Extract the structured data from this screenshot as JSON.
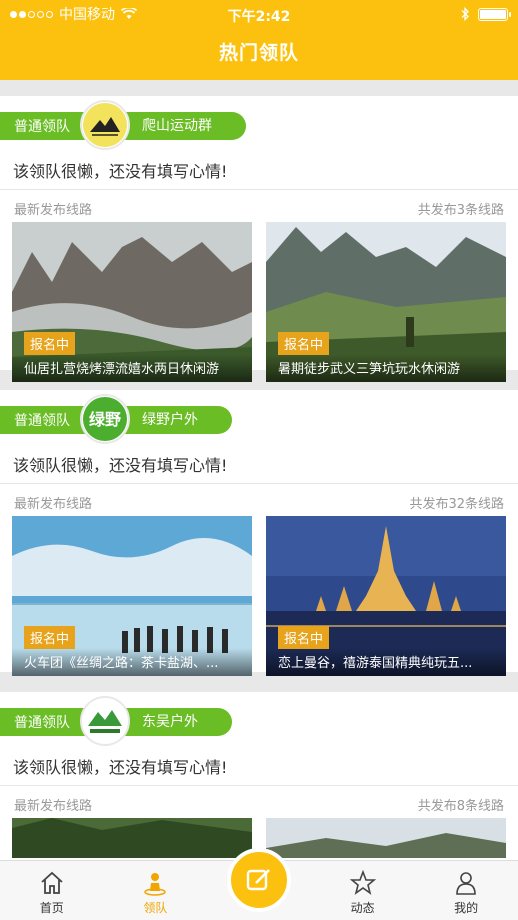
{
  "status_bar": {
    "carrier": "中国移动",
    "time": "下午2:42"
  },
  "header": {
    "title": "热门领队"
  },
  "cards": [
    {
      "type_label": "普通领队",
      "name": "爬山运动群",
      "motto": "该领队很懒，还没有填写心情!",
      "latest_label": "最新发布线路",
      "route_count": "共发布3条线路",
      "routes": [
        {
          "status": "报名中",
          "title": "仙居扎营烧烤漂流嬉水两日休闲游"
        },
        {
          "status": "报名中",
          "title": "暑期徒步武义三笋坑玩水休闲游"
        }
      ]
    },
    {
      "type_label": "普通领队",
      "name": "绿野户外",
      "logo_text": "绿野",
      "motto": "该领队很懒，还没有填写心情!",
      "latest_label": "最新发布线路",
      "route_count": "共发布32条线路",
      "routes": [
        {
          "status": "报名中",
          "title": "火车团《丝绸之路：茶卡盐湖、..."
        },
        {
          "status": "报名中",
          "title": "恋上曼谷，禧游泰国精典纯玩五..."
        }
      ]
    },
    {
      "type_label": "普通领队",
      "name": "东吴户外",
      "motto": "该领队很懒，还没有填写心情!",
      "latest_label": "最新发布线路",
      "route_count": "共发布8条线路",
      "routes": []
    }
  ],
  "tabbar": {
    "items": [
      {
        "label": "首页",
        "icon": "home-icon"
      },
      {
        "label": "领队",
        "icon": "leader-icon"
      },
      {
        "label": "",
        "icon": "compose-icon"
      },
      {
        "label": "动态",
        "icon": "star-icon"
      },
      {
        "label": "我的",
        "icon": "user-icon"
      }
    ],
    "active": "领队"
  },
  "colors": {
    "brand": "#fcc10f",
    "tag_green": "#6abd24",
    "status_orange": "#e6a31b"
  }
}
